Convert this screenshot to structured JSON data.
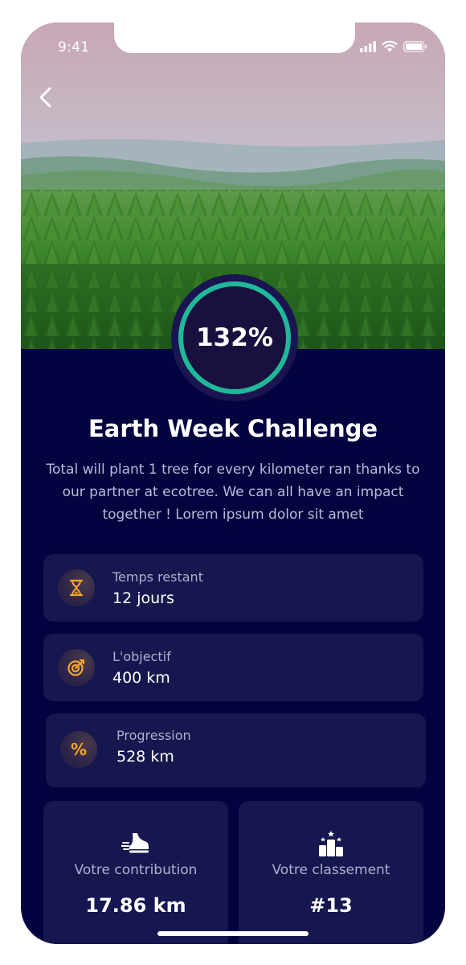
{
  "status_bar": {
    "time": "9:41"
  },
  "challenge": {
    "progress_text": "132%",
    "progress_fraction": 1.32,
    "ring_color": "#1fb99a",
    "title": "Earth Week Challenge",
    "description": "Total will plant 1 tree for every kilometer ran thanks to our partner at ecotree. We can all have an impact together ! Lorem ipsum dolor sit amet"
  },
  "info_cards": [
    {
      "icon": "hourglass-icon",
      "label": "Temps restant",
      "value": "12 jours"
    },
    {
      "icon": "target-icon",
      "label": "L'objectif",
      "value": "400 km"
    },
    {
      "icon": "percent-icon",
      "label": "Progression",
      "value": "528 km"
    }
  ],
  "stats": [
    {
      "icon": "running-shoe-icon",
      "label": "Votre contribution",
      "value": "17.86 km"
    },
    {
      "icon": "podium-icon",
      "label": "Votre classement",
      "value": "#13"
    }
  ],
  "colors": {
    "background": "#03033f",
    "card": "#16174f",
    "accent_orange": "#f4a72c",
    "accent_green": "#1fb99a"
  }
}
